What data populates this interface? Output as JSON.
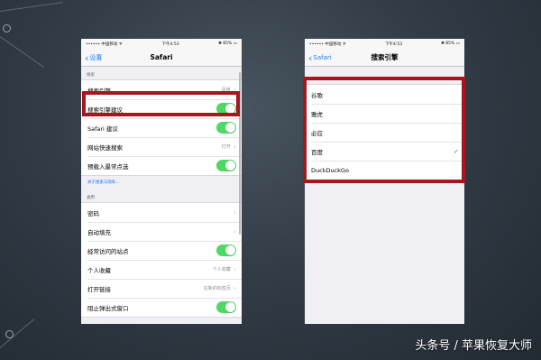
{
  "left_screen": {
    "status": {
      "carrier": "•••••• 中国移动 ᯤ",
      "time": "下午4:53",
      "battery": "✱ 85% ▭"
    },
    "nav": {
      "back_label": "设置",
      "title": "Safari"
    },
    "section_search": {
      "header": "搜索",
      "rows": [
        {
          "label": "搜索引擎",
          "value": "百度"
        },
        {
          "label": "搜索引擎建议"
        },
        {
          "label": "Safari 建议"
        },
        {
          "label": "网站快速搜索",
          "value": "打开"
        },
        {
          "label": "预载入最常点选"
        }
      ],
      "footer_link": "关于搜索与隐私..."
    },
    "section_general": {
      "header": "通用",
      "rows": [
        {
          "label": "密码"
        },
        {
          "label": "自动填充"
        },
        {
          "label": "经常访问的站点"
        },
        {
          "label": "个人收藏",
          "value": "个人收藏"
        },
        {
          "label": "打开链接",
          "value": "在新的标签页"
        },
        {
          "label": "阻止弹出式窗口"
        }
      ]
    }
  },
  "right_screen": {
    "status": {
      "carrier": "•••••• 中国移动 ᯤ",
      "time": "下午4:53",
      "battery": "✱ 85% ▭"
    },
    "nav": {
      "back_label": "Safari",
      "title": "搜索引擎"
    },
    "engines": [
      {
        "label": "谷歌",
        "selected": false
      },
      {
        "label": "雅虎",
        "selected": false
      },
      {
        "label": "必应",
        "selected": false
      },
      {
        "label": "百度",
        "selected": true
      },
      {
        "label": "DuckDuckGo",
        "selected": false
      }
    ],
    "check_glyph": "✓"
  },
  "watermark": "头条号 / 苹果恢复大师",
  "colors": {
    "highlight": "#a5161d",
    "ios_blue": "#1b7cf6",
    "toggle_on": "#4cd964"
  }
}
